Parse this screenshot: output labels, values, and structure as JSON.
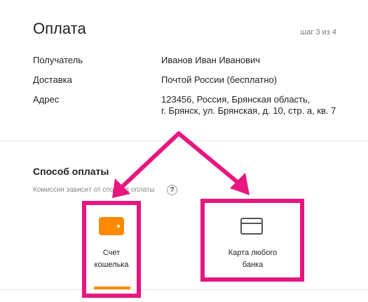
{
  "header": {
    "title": "Оплата",
    "step": "шаг 3 из 4"
  },
  "details": {
    "recipient_label": "Получатель",
    "recipient_value": "Иванов Иван Иванович",
    "delivery_label": "Доставка",
    "delivery_value": "Почтой России (бесплатно)",
    "address_label": "Адрес",
    "address_line1": "123456, Россия, Брянская область,",
    "address_line2": "г. Брянск, ул. Брянская, д. 10, стр. а, кв. 7"
  },
  "payment": {
    "title": "Способ оплаты",
    "hint": "Комиссия зависит от способа оплаты",
    "help": "?",
    "methods": [
      {
        "line1": "Счет",
        "line2": "кошелька",
        "icon": "wallet-icon",
        "selected": true
      },
      {
        "line1": "Карта любого",
        "line2": "банка",
        "icon": "card-icon",
        "selected": false
      }
    ]
  },
  "colors": {
    "accent": "#ff8a00",
    "annotation": "#e8167f"
  }
}
